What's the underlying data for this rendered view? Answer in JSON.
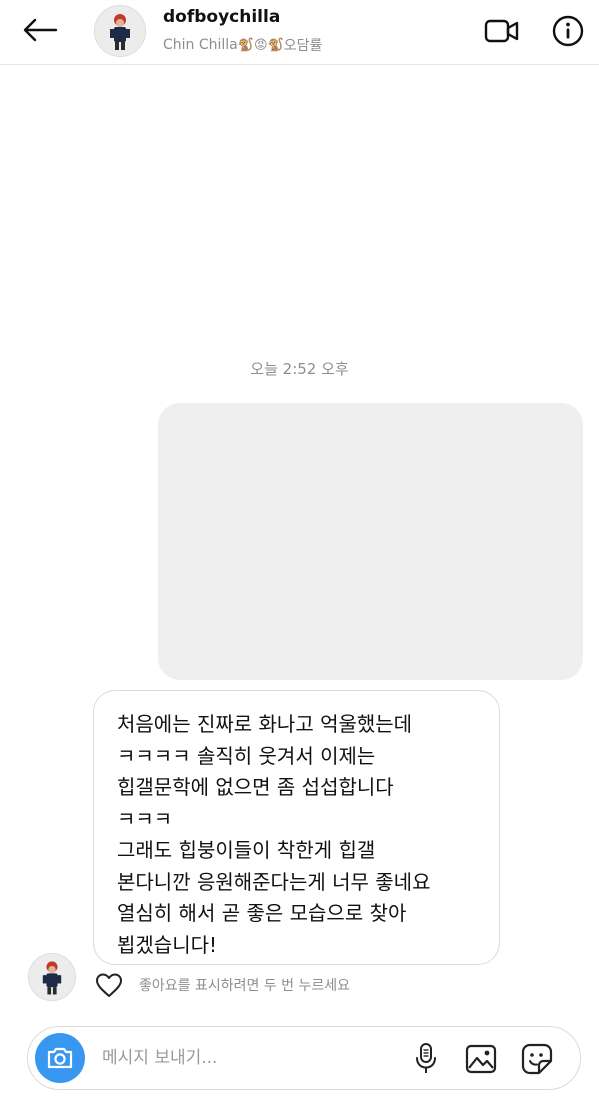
{
  "header": {
    "username": "dofboychilla",
    "subtitle_name": "Chin Chilla",
    "subtitle_emojis": "🐒😡🐒",
    "subtitle_tail": "오담률"
  },
  "thread": {
    "timestamp": "오늘 2:52 오후",
    "message_lines": [
      "처음에는 진짜로 화나고 억울했는데",
      "ㅋㅋㅋㅋ 솔직히 웃겨서 이제는",
      "힙갤문학에 없으면 좀 섭섭합니다",
      "ㅋㅋㅋ",
      "그래도 힙붕이들이 착한게 힙갤",
      "본다니깐 응원해준다는게 너무 좋네요",
      "열심히 해서 곧 좋은 모습으로 찾아",
      "뵙겠습니다!"
    ],
    "like_hint": "좋아요를 표시하려면 두 번 누르세요"
  },
  "composer": {
    "placeholder": "메시지 보내기..."
  },
  "icons": {
    "back": "arrow-left-icon",
    "video": "video-camera-icon",
    "info": "info-icon",
    "heart": "heart-icon",
    "camera": "camera-icon",
    "mic": "microphone-icon",
    "gallery": "image-icon",
    "sticker": "sticker-icon"
  },
  "colors": {
    "accent": "#3897f0",
    "muted_text": "#8e8e8e",
    "media_placeholder": "#efefef"
  }
}
